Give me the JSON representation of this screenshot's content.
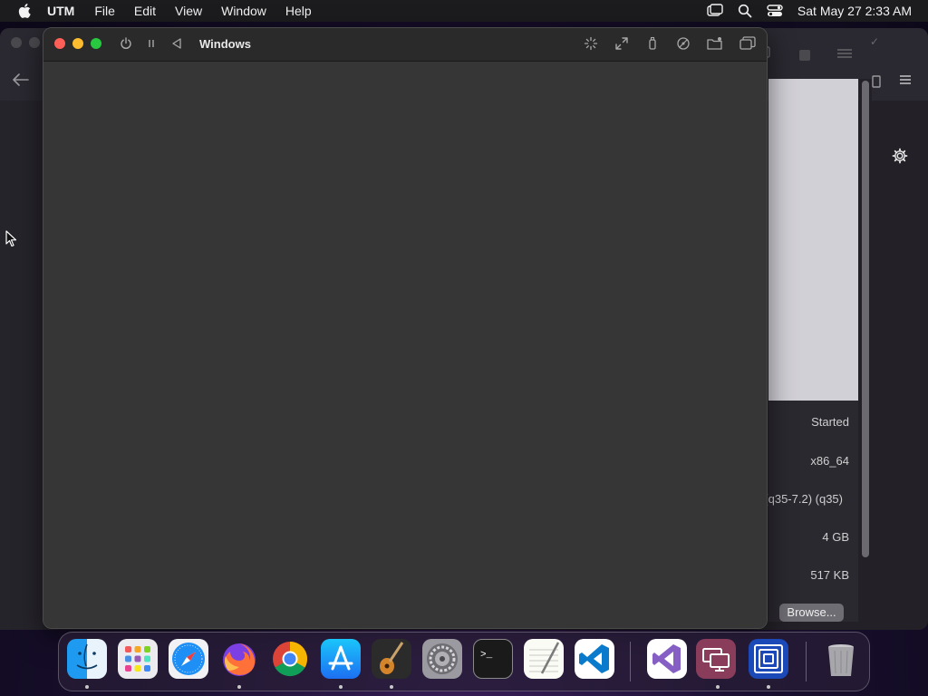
{
  "menubar": {
    "app_name": "UTM",
    "items": [
      "File",
      "Edit",
      "View",
      "Window",
      "Help"
    ],
    "clock": "Sat May 27  2:33 AM"
  },
  "vm_window": {
    "title": "Windows"
  },
  "details": {
    "status": "Started",
    "architecture": "x86_64",
    "machine": "(q35-7.2) (q35)",
    "memory": "4 GB",
    "size": "517 KB",
    "browse_label": "Browse..."
  },
  "dock": {
    "apps": [
      "Finder",
      "Launchpad",
      "Safari",
      "Firefox",
      "Google Chrome",
      "App Store",
      "GarageBand",
      "System Preferences",
      "Terminal",
      "TextEdit",
      "Visual Studio Code",
      "Visual Studio",
      "Remote Desktop",
      "UTM",
      "Trash"
    ]
  },
  "colors": {
    "accent": "#0a84ff",
    "close": "#fe5f57",
    "minimize": "#febc2e",
    "maximize": "#28c840"
  }
}
